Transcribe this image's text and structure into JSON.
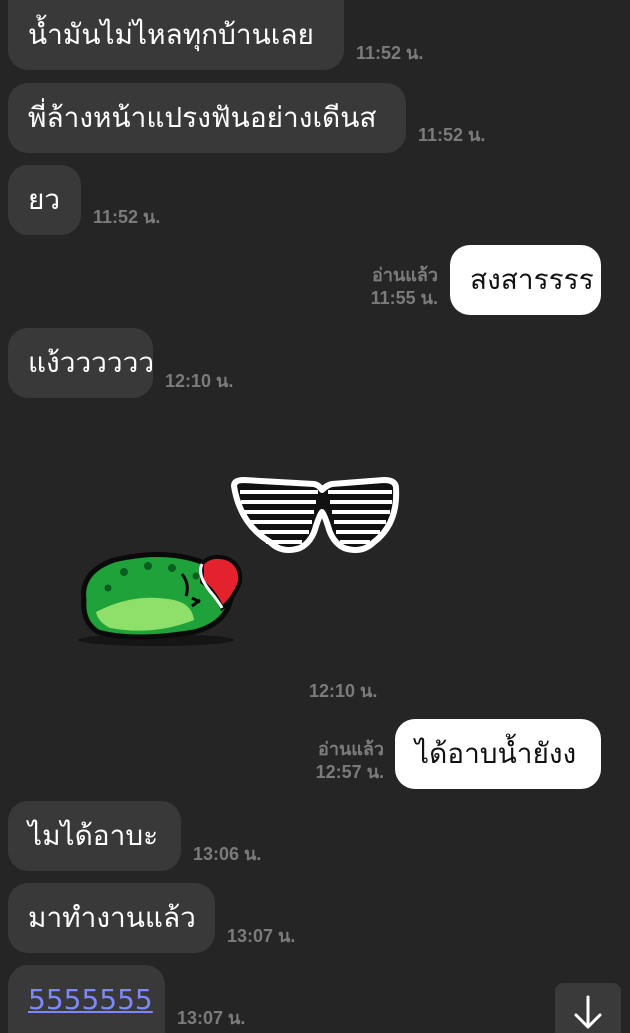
{
  "messages": [
    {
      "id": "m1",
      "direction": "in",
      "text": "น้ำมันไม่ไหลทุกบ้านเลย",
      "time": "11:52 น."
    },
    {
      "id": "m2",
      "direction": "in",
      "text": "พี่ล้างหน้าแปรงฟันอย่างเดีนส",
      "time": "11:52 น."
    },
    {
      "id": "m3",
      "direction": "in",
      "text": "ยว",
      "time": "11:52 น."
    },
    {
      "id": "m4",
      "direction": "out",
      "text": "สงสารรรร",
      "read": "อ่านแล้ว",
      "time": "11:55 น."
    },
    {
      "id": "m5",
      "direction": "in",
      "text": "แง้วววววว",
      "time": "12:10 น."
    },
    {
      "id": "m6",
      "direction": "in",
      "sticker": "cucumber-sunglasses-sticker",
      "time": "12:10 น."
    },
    {
      "id": "m7",
      "direction": "out",
      "text": "ได้อาบน้ำยังง",
      "read": "อ่านแล้ว",
      "time": "12:57 น."
    },
    {
      "id": "m8",
      "direction": "in",
      "text": "ไมได้อาบะ",
      "time": "13:06 น."
    },
    {
      "id": "m9",
      "direction": "in",
      "text": "มาทำงานแล้ว",
      "time": "13:07 น."
    },
    {
      "id": "m10",
      "direction": "in",
      "text": "5555555",
      "time": "13:07 น.",
      "is_link": true
    }
  ],
  "scroll_button": {
    "icon": "arrow-down-icon"
  },
  "colors": {
    "background": "#252525",
    "incoming_bubble": "#393939",
    "outgoing_bubble": "#ffffff",
    "timestamp": "#7b7b7b",
    "link": "#7d87ff"
  }
}
